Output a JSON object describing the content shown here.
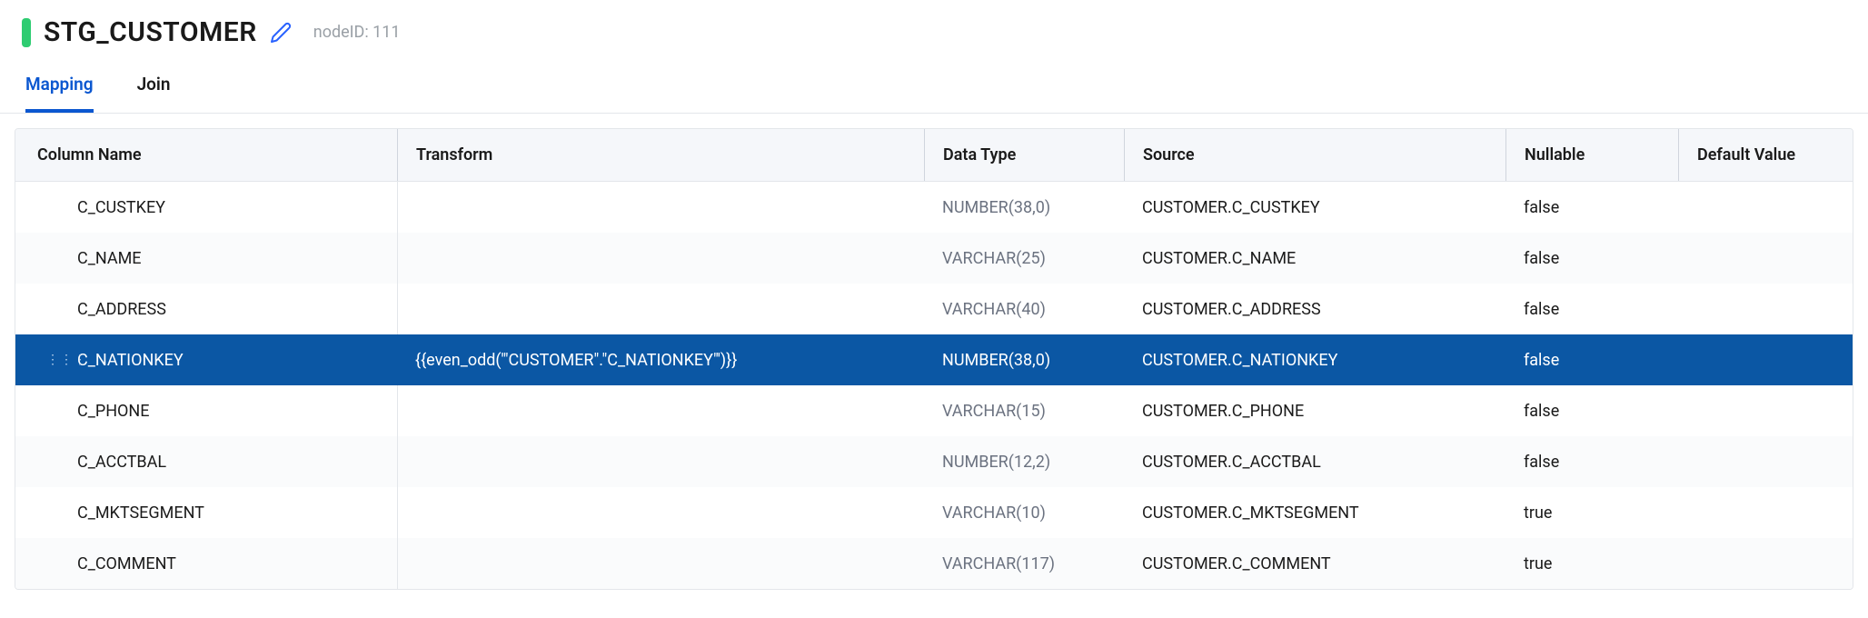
{
  "header": {
    "title": "STG_CUSTOMER",
    "node_id": "nodeID: 111"
  },
  "tabs": {
    "mapping": "Mapping",
    "join": "Join",
    "active": "mapping"
  },
  "columns": {
    "col_name": "Column Name",
    "transform": "Transform",
    "data_type": "Data Type",
    "source": "Source",
    "nullable": "Nullable",
    "default_value": "Default Value"
  },
  "rows": [
    {
      "name": "C_CUSTKEY",
      "transform": "",
      "data_type": "NUMBER(38,0)",
      "source": "CUSTOMER.C_CUSTKEY",
      "nullable": "false",
      "default_value": "",
      "selected": false
    },
    {
      "name": "C_NAME",
      "transform": "",
      "data_type": "VARCHAR(25)",
      "source": "CUSTOMER.C_NAME",
      "nullable": "false",
      "default_value": "",
      "selected": false
    },
    {
      "name": "C_ADDRESS",
      "transform": "",
      "data_type": "VARCHAR(40)",
      "source": "CUSTOMER.C_ADDRESS",
      "nullable": "false",
      "default_value": "",
      "selected": false
    },
    {
      "name": "C_NATIONKEY",
      "transform": "{{even_odd('\"CUSTOMER\".\"C_NATIONKEY\"')}}",
      "data_type": "NUMBER(38,0)",
      "source": "CUSTOMER.C_NATIONKEY",
      "nullable": "false",
      "default_value": "",
      "selected": true
    },
    {
      "name": "C_PHONE",
      "transform": "",
      "data_type": "VARCHAR(15)",
      "source": "CUSTOMER.C_PHONE",
      "nullable": "false",
      "default_value": "",
      "selected": false
    },
    {
      "name": "C_ACCTBAL",
      "transform": "",
      "data_type": "NUMBER(12,2)",
      "source": "CUSTOMER.C_ACCTBAL",
      "nullable": "false",
      "default_value": "",
      "selected": false
    },
    {
      "name": "C_MKTSEGMENT",
      "transform": "",
      "data_type": "VARCHAR(10)",
      "source": "CUSTOMER.C_MKTSEGMENT",
      "nullable": "true",
      "default_value": "",
      "selected": false
    },
    {
      "name": "C_COMMENT",
      "transform": "",
      "data_type": "VARCHAR(117)",
      "source": "CUSTOMER.C_COMMENT",
      "nullable": "true",
      "default_value": "",
      "selected": false
    }
  ]
}
